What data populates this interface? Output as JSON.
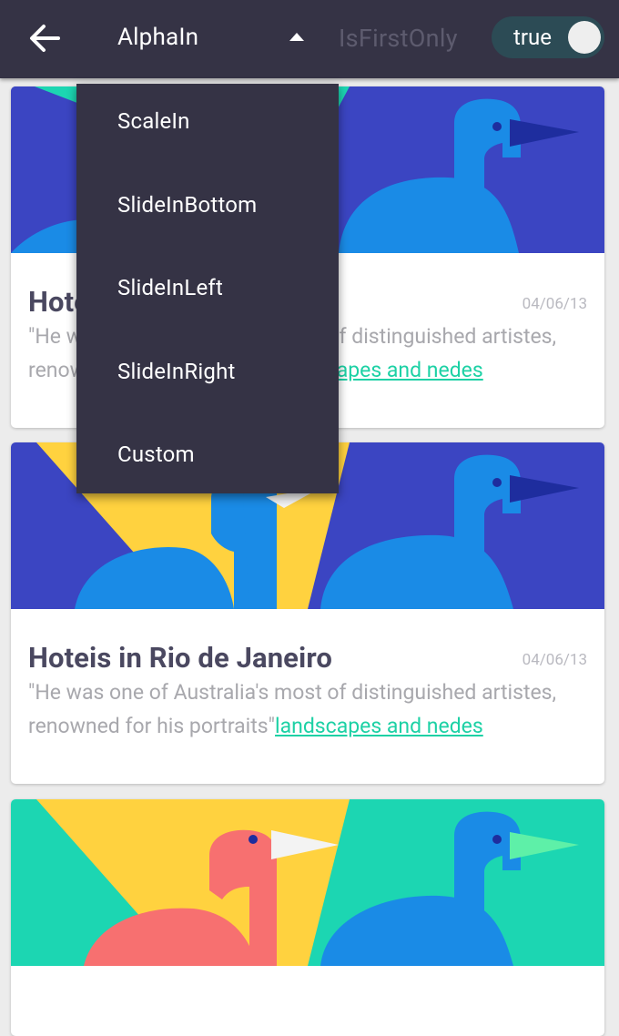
{
  "toolbar": {
    "back_icon": "arrow-left-icon",
    "animation_spinner_value": "AlphaIn",
    "first_only_label": "IsFirstOnly",
    "first_only_toggle_text": "true"
  },
  "animation_menu": {
    "items": [
      "ScaleIn",
      "SlideInBottom",
      "SlideInLeft",
      "SlideInRight",
      "Custom"
    ]
  },
  "cards": [
    {
      "title": "Hoteis in Rio de Janeiro",
      "date": "04/06/13",
      "description": "\"He was one of Australia's most of distinguished artistes, renowned for his portraits\"",
      "link_text": "landscapes and nedes"
    },
    {
      "title": "Hoteis in Rio de Janeiro",
      "date": "04/06/13",
      "description": "\"He was one of Australia's most of distinguished artistes, renowned for his portraits\"",
      "link_text": "landscapes and nedes"
    }
  ],
  "colors": {
    "toolbar": "#353345",
    "accent": "#1dd1a5",
    "toggle_track": "#2c4b55",
    "background": "#ececec"
  }
}
